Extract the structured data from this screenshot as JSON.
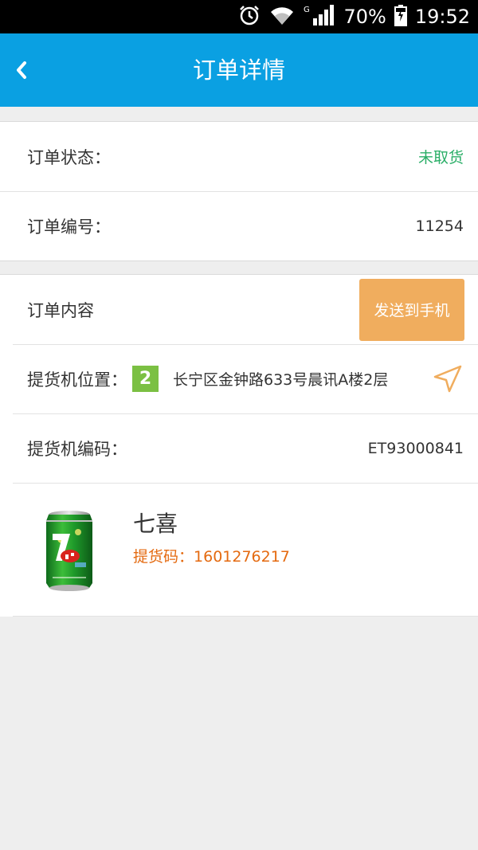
{
  "status_bar": {
    "battery": "70%",
    "time": "19:52",
    "network": "G",
    "icons": [
      "alarm-icon",
      "wifi-icon",
      "cell-signal-icon",
      "battery-icon"
    ]
  },
  "header": {
    "title": "订单详情",
    "back_icon": "chevron-left-icon"
  },
  "order": {
    "status_label": "订单状态：",
    "status_value": "未取货",
    "status_color": "#2aae67",
    "number_label": "订单编号：",
    "number_value": "11254"
  },
  "content": {
    "title": "订单内容",
    "send_button": "发送到手机",
    "location_label": "提货机位置：",
    "line_badge": "2",
    "address": "长宁区金钟路633号晨讯A楼2层",
    "machine_code_label": "提货机编码：",
    "machine_code_value": "ET93000841"
  },
  "product": {
    "name": "七喜",
    "pickup_label": "提货码：",
    "pickup_code": "1601276217",
    "image": "7up-can"
  },
  "colors": {
    "header": "#0aa0e2",
    "button": "#f0ad5e",
    "badge": "#7bc043",
    "pickup_text": "#e46a10"
  }
}
